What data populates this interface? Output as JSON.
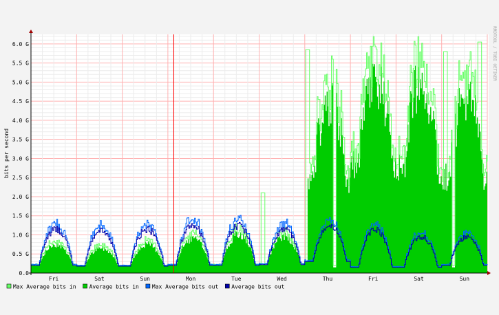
{
  "chart_data": {
    "type": "area",
    "ylabel": "bits per second",
    "watermark": "RRDTOOL / TOBI OETIKER",
    "y_ticks": [
      "0.0",
      "0.5 G",
      "1.0 G",
      "1.5 G",
      "2.0 G",
      "2.5 G",
      "3.0 G",
      "3.5 G",
      "4.0 G",
      "4.5 G",
      "5.0 G",
      "5.5 G",
      "6.0 G"
    ],
    "ylim": [
      0,
      6.25
    ],
    "y_unit": "Gbit/s",
    "x_ticks": [
      "Fri",
      "Sat",
      "Sun",
      "Mon",
      "Tue",
      "Wed",
      "Thu",
      "Fri",
      "Sat",
      "Sun"
    ],
    "x_range_days": [
      0,
      10
    ],
    "now_marker_day": 3.13,
    "series": [
      {
        "name": "Max Average bits in",
        "color": "#66ff66"
      },
      {
        "name": "Average bits in",
        "color": "#00cc00"
      },
      {
        "name": "Max Average bits out",
        "color": "#0066ff"
      },
      {
        "name": "Average bits out",
        "color": "#0000aa"
      }
    ],
    "data_points_per_day": 48,
    "daily_peak_in": [
      0.75,
      0.65,
      0.75,
      0.9,
      1.0,
      0.95,
      4.4,
      5.05,
      5.0,
      4.6
    ],
    "daily_peak_out": [
      1.15,
      1.1,
      1.15,
      1.25,
      1.25,
      1.15,
      1.25,
      1.15,
      0.95,
      0.95
    ],
    "daily_trough": [
      0.2,
      0.18,
      0.18,
      0.2,
      0.2,
      0.22,
      0.3,
      0.15,
      0.15,
      0.2
    ],
    "spikes": [
      {
        "day": 5.05,
        "max_in": 2.1
      },
      {
        "day": 6.02,
        "max_in": 5.85
      },
      {
        "day": 9.04,
        "max_in": 5.8
      },
      {
        "day": 9.8,
        "max_in": 6.05
      }
    ],
    "gaps_in": [
      6.64,
      9.25
    ]
  }
}
